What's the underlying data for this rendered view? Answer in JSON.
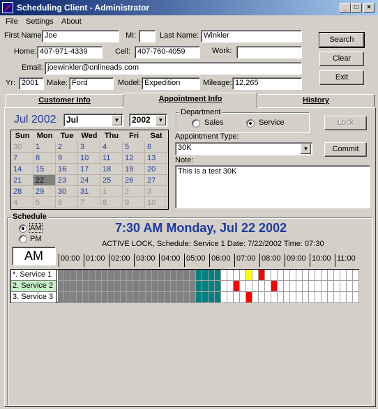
{
  "window": {
    "title": "Scheduling Client - Administrator"
  },
  "menu": [
    "File",
    "Settings",
    "About"
  ],
  "customer": {
    "first_name_label": "First Name:",
    "first_name": "Joe",
    "mi_label": "MI:",
    "mi": "",
    "last_name_label": "Last Name:",
    "last_name": "Winkler",
    "home_label": "Home:",
    "home": "407-971-4339",
    "cell_label": "Cell:",
    "cell": "407-760-4059",
    "work_label": "Work:",
    "work": "",
    "email_label": "Email:",
    "email": "joewinkler@onlineads.com",
    "yr_label": "Yr:",
    "yr": "2001",
    "make_label": "Make:",
    "make": "Ford",
    "model_label": "Model:",
    "model": "Expedition",
    "mileage_label": "Mileage:",
    "mileage": "12,265"
  },
  "buttons": {
    "search": "Search",
    "clear": "Clear",
    "exit": "Exit",
    "lock": "Lock",
    "commit": "Commit"
  },
  "tabs": [
    "Customer Info",
    "Appointment Info",
    "History"
  ],
  "calendar": {
    "title": "Jul 2002",
    "month": "Jul",
    "year": "2002",
    "weekdays": [
      "Sun",
      "Mon",
      "Tue",
      "Wed",
      "Thu",
      "Fri",
      "Sat"
    ],
    "weeks": [
      [
        "30",
        "1",
        "2",
        "3",
        "4",
        "5",
        "6"
      ],
      [
        "7",
        "8",
        "9",
        "10",
        "11",
        "12",
        "13"
      ],
      [
        "14",
        "15",
        "16",
        "17",
        "18",
        "19",
        "20"
      ],
      [
        "21",
        "22",
        "23",
        "24",
        "25",
        "26",
        "27"
      ],
      [
        "28",
        "29",
        "30",
        "31",
        "1",
        "2",
        "3"
      ],
      [
        "4",
        "5",
        "6",
        "7",
        "8",
        "9",
        "10"
      ]
    ],
    "selected_day": "22"
  },
  "department": {
    "title": "Department",
    "options": [
      "Sales",
      "Service"
    ],
    "selected": "Service"
  },
  "appointment": {
    "type_label": "Appointment Type:",
    "type": "30K",
    "note_label": "Note:",
    "note": "This is a test 30K"
  },
  "schedule": {
    "title": "Schedule",
    "am_label": "AM",
    "pm_label": "PM",
    "selected": "AM",
    "period_display": "AM",
    "headline": "7:30 AM Monday, Jul 22 2002",
    "status": "ACTIVE LOCK, Schedule: Service 1  Date: 7/22/2002  Time: 07:30",
    "hours": [
      "00:00",
      "01:00",
      "02:00",
      "03:00",
      "04:00",
      "05:00",
      "06:00",
      "07:00",
      "08:00",
      "09:00",
      "10:00",
      "11:00"
    ],
    "rows": [
      "*. Service 1",
      "2. Service 2",
      "3. Service 3"
    ],
    "colors": {
      "closed": "#808080",
      "teal": "#008080",
      "open": "#ffffff",
      "booked": "#ff0000",
      "pending": "#ffff00",
      "selected_row": "#c8f0c8"
    }
  }
}
